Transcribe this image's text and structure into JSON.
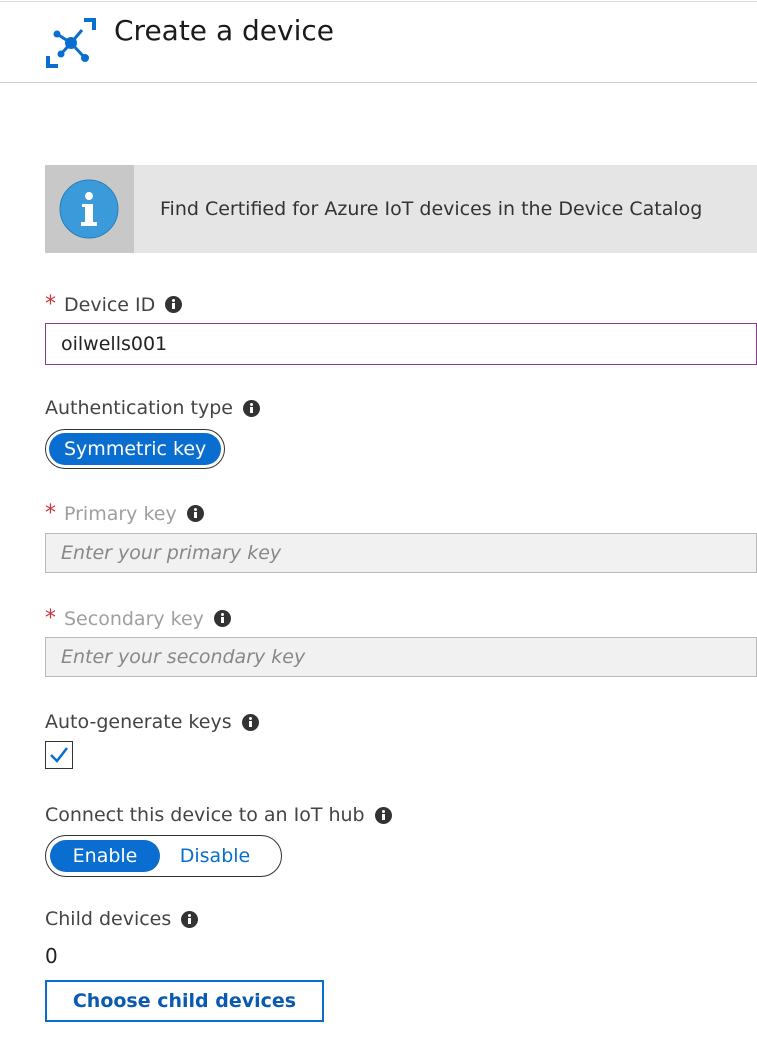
{
  "header": {
    "title": "Create a device",
    "icon": "iot-device-icon"
  },
  "info_banner": {
    "text": "Find Certified for Azure IoT devices in the Device Catalog",
    "icon": "info-icon"
  },
  "device_id": {
    "label": "Device ID",
    "required_mark": "*",
    "value": "oilwells001"
  },
  "auth_type": {
    "label": "Authentication type",
    "selected": "Symmetric key"
  },
  "primary_key": {
    "label": "Primary key",
    "required_mark": "*",
    "placeholder": "Enter your primary key"
  },
  "secondary_key": {
    "label": "Secondary key",
    "required_mark": "*",
    "placeholder": "Enter your secondary key"
  },
  "auto_generate": {
    "label": "Auto-generate keys",
    "checked": true
  },
  "connect_hub": {
    "label": "Connect this device to an IoT hub",
    "enable": "Enable",
    "disable": "Disable",
    "selected": "Enable"
  },
  "child_devices": {
    "label": "Child devices",
    "count": "0",
    "button": "Choose child devices"
  },
  "colors": {
    "accent": "#0a6ed1",
    "required": "#d13438",
    "focus_border": "#8a3a8f"
  }
}
